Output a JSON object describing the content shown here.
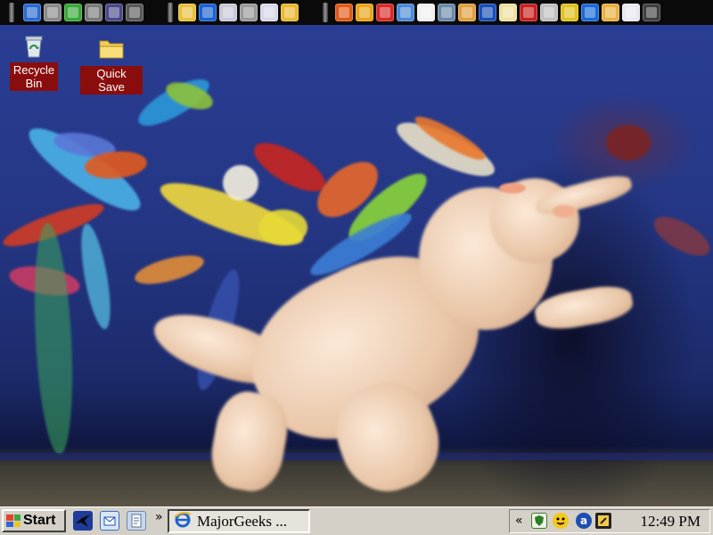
{
  "desktop": {
    "icons": [
      {
        "label": "Recycle Bin",
        "icon": "recycle-bin-icon"
      },
      {
        "label": "Quick Save",
        "icon": "folder-icon"
      }
    ]
  },
  "quick_launch_top": {
    "group1_icons": [
      "screen-icon",
      "pencil-icon",
      "frog-icon",
      "wrench-icon",
      "chart-icon",
      "hat-icon"
    ],
    "group2_icons": [
      "folder-icon",
      "internet-explorer-icon",
      "mail-icon",
      "tools-icon",
      "cloud-icon",
      "notepad-icon"
    ],
    "group3_icons": [
      "refresh-icon",
      "alarm-icon",
      "block-icon",
      "gear-icon",
      "calendar-icon",
      "monitor-icon",
      "maze-icon",
      "aol-icon",
      "shield-icon",
      "acrobat-icon",
      "tools2-icon",
      "grid-icon",
      "browser-icon",
      "plugin-icon",
      "remove-icon",
      "help-icon"
    ]
  },
  "taskbar": {
    "start_label": "Start",
    "quick_launch": [
      "bird-icon",
      "outlook-icon",
      "document-icon"
    ],
    "overflow_chevron": "»",
    "task_button_label": "MajorGeeks ...",
    "tray_chevron": "«",
    "tray_icons": [
      "security-shield-icon",
      "smiley-messenger-icon",
      "aol-tray-icon",
      "notes-tray-icon"
    ],
    "clock": "12:49 PM"
  },
  "colors": {
    "label_bg": "#8a0d0d",
    "taskbar_bg": "#d4d0c8",
    "topbar_bg": "#0a0a0a"
  }
}
